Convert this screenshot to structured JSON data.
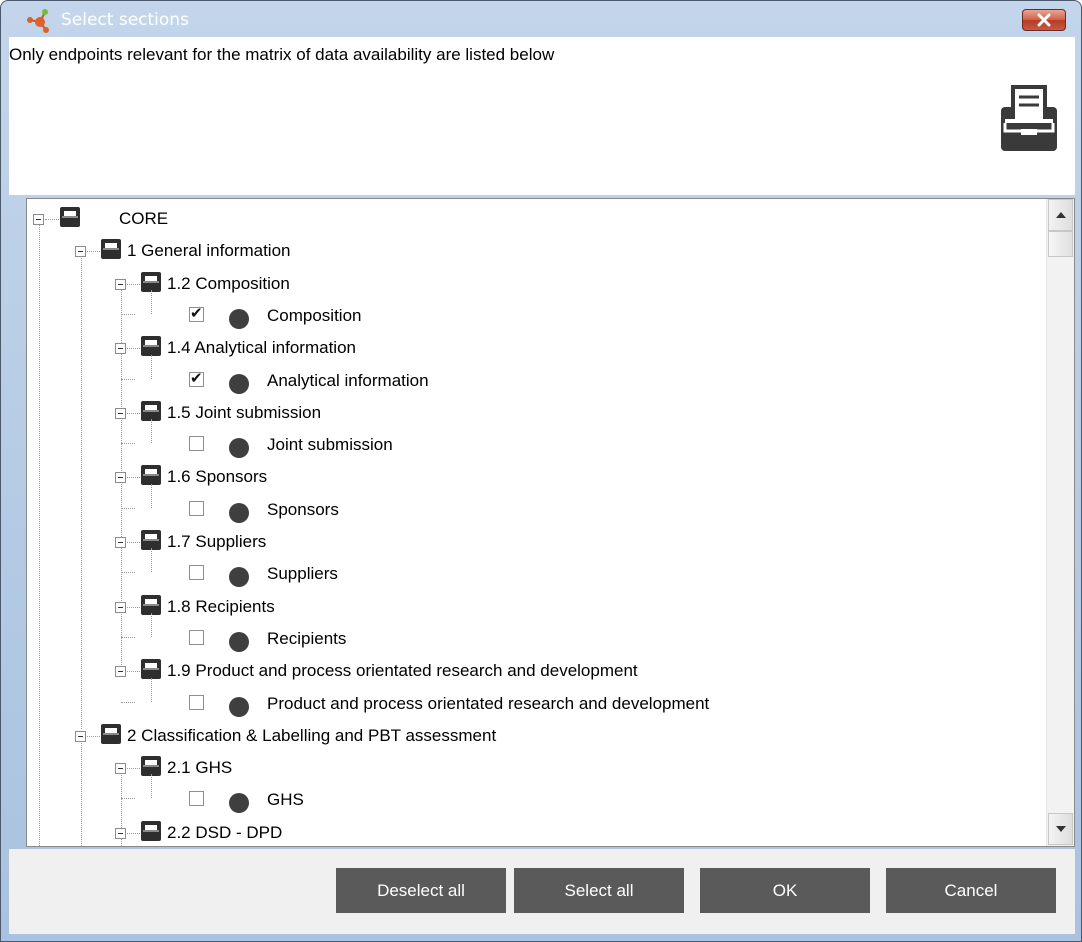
{
  "window": {
    "title": "Select sections",
    "description": "Only endpoints relevant for the matrix of data availability are listed below"
  },
  "tree": [
    {
      "label": "CORE",
      "level": 0,
      "type": "folder"
    },
    {
      "label": "1 General information",
      "level": 1,
      "type": "folder"
    },
    {
      "label": "1.2 Composition",
      "level": 2,
      "type": "folder"
    },
    {
      "label": "Composition",
      "level": 3,
      "type": "endpoint",
      "checked": true
    },
    {
      "label": "1.4 Analytical information",
      "level": 2,
      "type": "folder"
    },
    {
      "label": "Analytical information",
      "level": 3,
      "type": "endpoint",
      "checked": true
    },
    {
      "label": "1.5 Joint submission",
      "level": 2,
      "type": "folder"
    },
    {
      "label": "Joint submission",
      "level": 3,
      "type": "endpoint",
      "checked": false
    },
    {
      "label": "1.6 Sponsors",
      "level": 2,
      "type": "folder"
    },
    {
      "label": "Sponsors",
      "level": 3,
      "type": "endpoint",
      "checked": false
    },
    {
      "label": "1.7 Suppliers",
      "level": 2,
      "type": "folder"
    },
    {
      "label": "Suppliers",
      "level": 3,
      "type": "endpoint",
      "checked": false
    },
    {
      "label": "1.8 Recipients",
      "level": 2,
      "type": "folder"
    },
    {
      "label": "Recipients",
      "level": 3,
      "type": "endpoint",
      "checked": false
    },
    {
      "label": "1.9 Product and process orientated research and development",
      "level": 2,
      "type": "folder"
    },
    {
      "label": "Product and process orientated research and development",
      "level": 3,
      "type": "endpoint",
      "checked": false
    },
    {
      "label": "2 Classification & Labelling and PBT assessment",
      "level": 1,
      "type": "folder"
    },
    {
      "label": "2.1 GHS",
      "level": 2,
      "type": "folder"
    },
    {
      "label": "GHS",
      "level": 3,
      "type": "endpoint",
      "checked": false
    },
    {
      "label": "2.2 DSD - DPD",
      "level": 2,
      "type": "folder"
    }
  ],
  "buttons": {
    "deselect_all": "Deselect all",
    "select_all": "Select all",
    "ok": "OK",
    "cancel": "Cancel"
  },
  "icons": {
    "app": "molecule-icon",
    "close": "close-icon",
    "drawer": "file-drawer-icon",
    "folder": "folder-icon",
    "endpoint": "endpoint-dot-icon"
  },
  "colors": {
    "titlebar": "#b4cae3",
    "button_bg": "#5a5a5a",
    "button_text": "#ffffff",
    "close_button": "#c9553d",
    "endpoint_dot": "#3f3f3f"
  }
}
